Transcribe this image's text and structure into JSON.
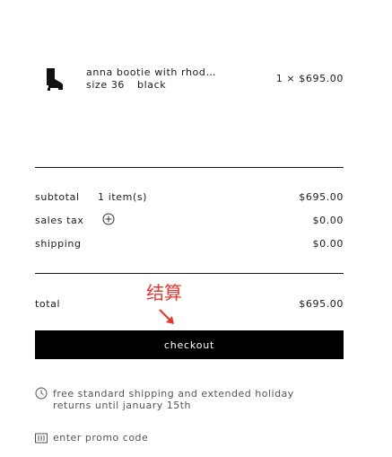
{
  "cart_item": {
    "name": "anna bootie with rhod…",
    "size": "size 36",
    "color": "black",
    "quantity_price": "1 × $695.00",
    "thumbnail_icon": "ankle-boot-icon"
  },
  "summary": {
    "subtotal_label": "subtotal",
    "subtotal_count": "1 item(s)",
    "subtotal_value": "$695.00",
    "tax_label": "sales tax",
    "tax_value": "$0.00",
    "shipping_label": "shipping",
    "shipping_value": "$0.00",
    "total_label": "total",
    "total_value": "$695.00"
  },
  "annotation": {
    "text": "结算",
    "color": "#e53935"
  },
  "checkout": {
    "label": "checkout",
    "background": "#000000"
  },
  "shipping_note": {
    "line1": "free standard shipping and extended holiday",
    "line2": "returns until january 15th",
    "icon": "clock-icon"
  },
  "promo": {
    "label": "enter promo code",
    "icon": "ticket-icon"
  }
}
